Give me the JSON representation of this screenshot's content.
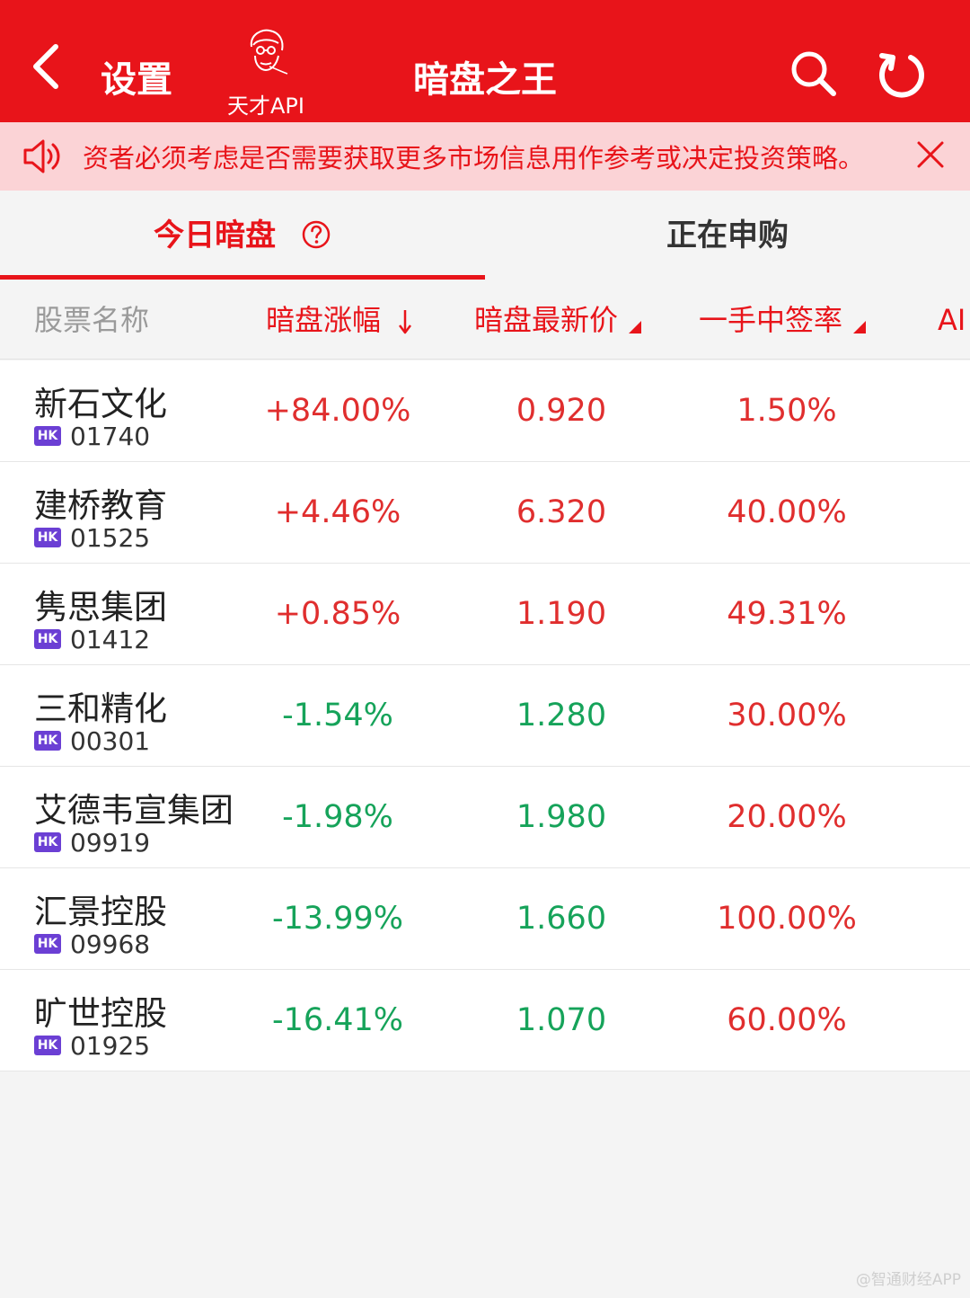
{
  "header": {
    "back_icon": "chevron-left-icon",
    "settings_label": "设置",
    "logo_text": "天才API",
    "title": "暗盘之王",
    "search_icon": "search-icon",
    "refresh_icon": "refresh-icon",
    "bg_color": "#e8141a"
  },
  "notice": {
    "icon": "speaker-icon",
    "text": "资者必须考虑是否需要获取更多市场信息用作参考或决定投资策略。",
    "close_icon": "close-icon",
    "bg_color": "#fbd3d6"
  },
  "tabs": [
    {
      "label": "今日暗盘",
      "active": true
    },
    {
      "label": "正在申购",
      "active": false
    }
  ],
  "columns": {
    "name": "股票名称",
    "change": "暗盘涨幅",
    "price": "暗盘最新价",
    "rate": "一手中签率",
    "ai": "AI"
  },
  "rows": [
    {
      "name": "新石文化",
      "market": "HK",
      "code": "01740",
      "change": "+84.00%",
      "price": "0.920",
      "rate": "1.50%",
      "dir": "up"
    },
    {
      "name": "建桥教育",
      "market": "HK",
      "code": "01525",
      "change": "+4.46%",
      "price": "6.320",
      "rate": "40.00%",
      "dir": "up"
    },
    {
      "name": "隽思集团",
      "market": "HK",
      "code": "01412",
      "change": "+0.85%",
      "price": "1.190",
      "rate": "49.31%",
      "dir": "up"
    },
    {
      "name": "三和精化",
      "market": "HK",
      "code": "00301",
      "change": "-1.54%",
      "price": "1.280",
      "rate": "30.00%",
      "dir": "down"
    },
    {
      "name": "艾德韦宣集团",
      "market": "HK",
      "code": "09919",
      "change": "-1.98%",
      "price": "1.980",
      "rate": "20.00%",
      "dir": "down"
    },
    {
      "name": "汇景控股",
      "market": "HK",
      "code": "09968",
      "change": "-13.99%",
      "price": "1.660",
      "rate": "100.00%",
      "dir": "down"
    },
    {
      "name": "旷世控股",
      "market": "HK",
      "code": "01925",
      "change": "-16.41%",
      "price": "1.070",
      "rate": "60.00%",
      "dir": "down"
    }
  ],
  "colors": {
    "up": "#e02e2e",
    "down": "#16a35a",
    "badge": "#6b3fd4"
  },
  "watermark": "@智通财经APP"
}
